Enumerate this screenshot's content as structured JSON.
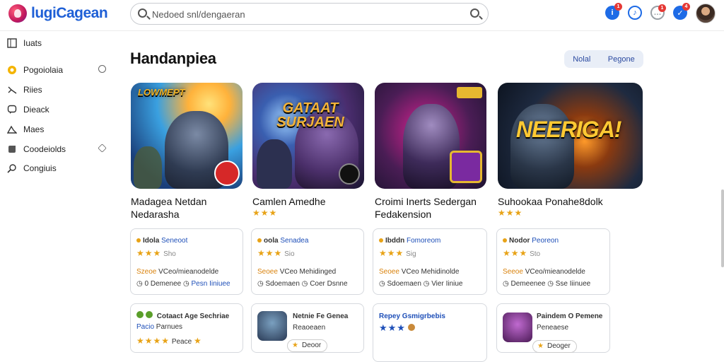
{
  "header": {
    "logo_text": "lugiCagean",
    "search_placeholder": "Nedoed snl/dengaeran",
    "icons": [
      {
        "name": "info-icon",
        "color": "#1e6be6",
        "badge": "1"
      },
      {
        "name": "bell-icon",
        "color": "#1e6be6",
        "badge": ""
      },
      {
        "name": "chat-icon",
        "color": "#9aa0a6",
        "badge": "1"
      },
      {
        "name": "check-icon",
        "color": "#1e6be6",
        "badge": "4"
      }
    ]
  },
  "sidebar": {
    "items": [
      {
        "label": "Iuats",
        "icon": "grid-icon"
      },
      {
        "label": "Pogoiolaia",
        "icon": "star-icon"
      },
      {
        "label": "Riies",
        "icon": "arrow-icon"
      },
      {
        "label": "Dieack",
        "icon": "chat-icon"
      },
      {
        "label": "Maes",
        "icon": "mountain-icon"
      },
      {
        "label": "Coodeiolds",
        "icon": "tag-icon"
      },
      {
        "label": "Congiuis",
        "icon": "search-icon"
      }
    ]
  },
  "main": {
    "title": "Handanpiea",
    "segment": {
      "left": "Nolal",
      "right": "Pegone"
    },
    "games": [
      {
        "name": "Madagea Netdan Nedarasha",
        "thumb_text": "LOWMEPT",
        "stars": ""
      },
      {
        "name": "Camlen Amedhe",
        "thumb_text": "GATAAT SURJAEN",
        "stars": "★★★"
      },
      {
        "name": "Croimi Inerts Sedergan Fedakension",
        "thumb_text": "",
        "stars": ""
      },
      {
        "name": "Suhookaa Ponahe8dolk",
        "thumb_text": "NEERIGA!",
        "stars": "★★★"
      }
    ],
    "review_cards": [
      {
        "user": "Idola",
        "badge": "Seneoot",
        "stars": "★★★",
        "meta": "Sho",
        "rating": "Szeoe",
        "desc": "VCeo/mieanodelde",
        "foot_left": "0 Demenee",
        "foot_right": "Pesn Iiniuee"
      },
      {
        "user": "oola",
        "badge": "Senadea",
        "stars": "★★★",
        "meta": "Sio",
        "rating": "Seoee",
        "desc": "VCeo Mehidinged",
        "foot_left": "Sdoemaen",
        "foot_right": "Coer Dsnne"
      },
      {
        "user": "Ibddn",
        "badge": "Fomoreom",
        "stars": "★★★",
        "meta": "Sig",
        "rating": "Seoee",
        "desc": "VCeo Mehidinolde",
        "foot_left": "Sdoemaen",
        "foot_right": "Vier Iiniue"
      },
      {
        "user": "Nodor",
        "badge": "Peoreon",
        "stars": "★★★",
        "meta": "Sto",
        "rating": "Seeoe",
        "desc": "VCeo/mieanodelde",
        "foot_left": "Demeenee",
        "foot_right": "Sse Iiinuee"
      }
    ],
    "list_cards": [
      {
        "title": "Cotaact Age Sechriae",
        "sub1": "Pacio",
        "sub2": "Parnues",
        "stars": "★★★★",
        "extra": "Peace"
      },
      {
        "title": "Netnie Fe Genea",
        "sub1": "Reaoeaen",
        "pill": "Deoor"
      },
      {
        "title": "Repey Gsmigrbebis",
        "stars": "★★★"
      },
      {
        "title": "Paindem O Pemene",
        "sub1": "Peneaese",
        "pill": "Deoger"
      }
    ]
  }
}
